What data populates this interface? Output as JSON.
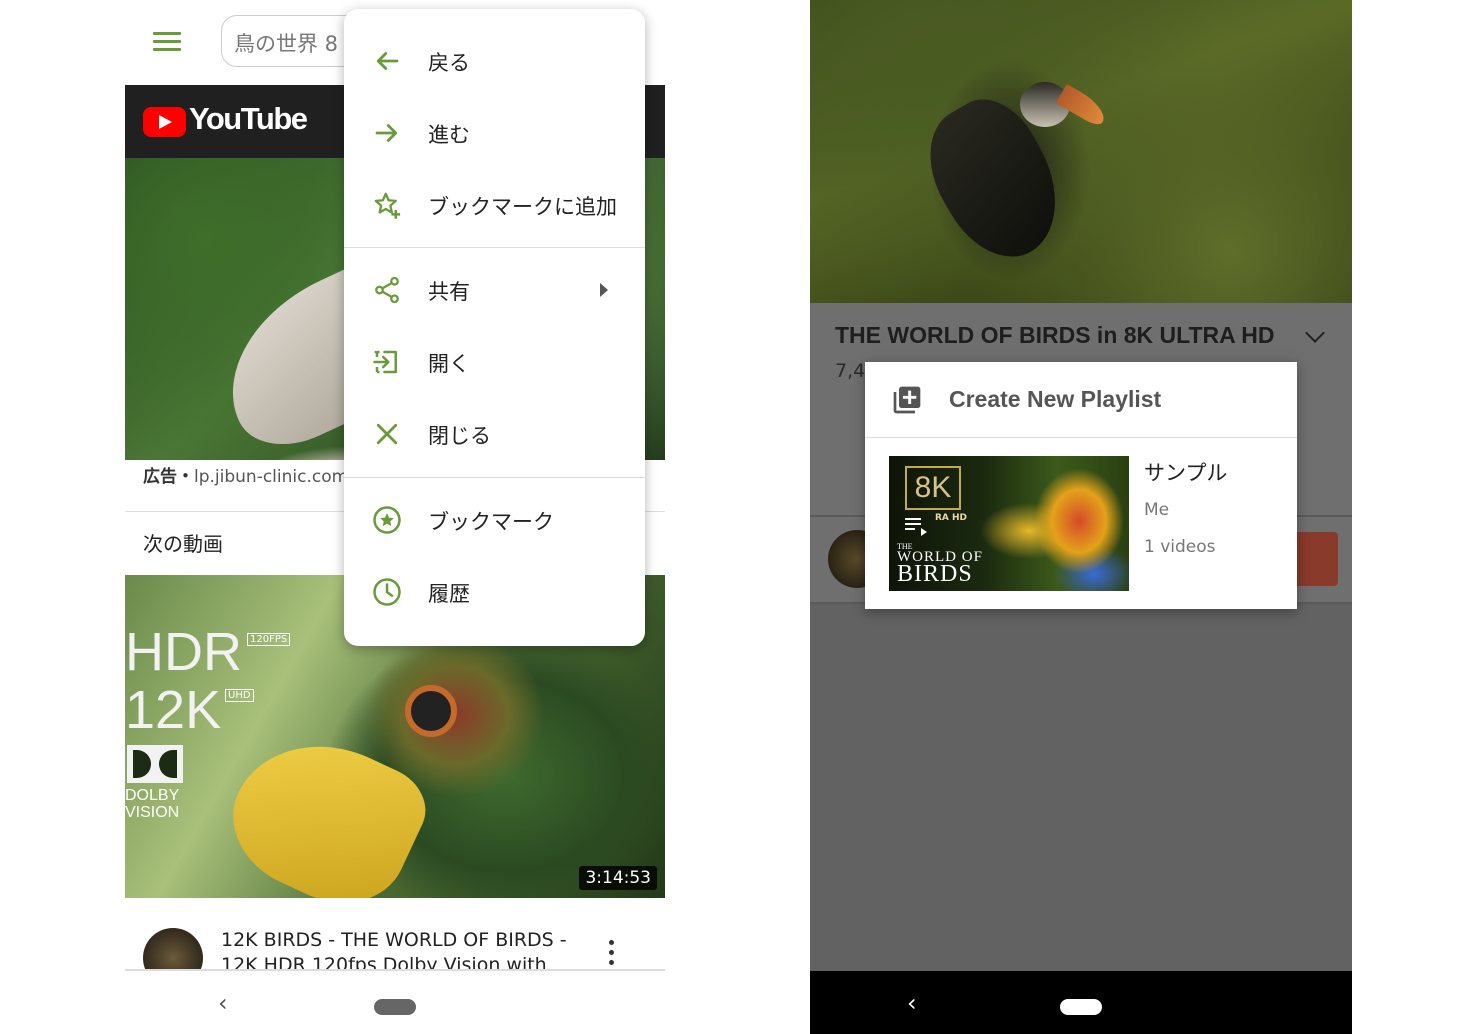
{
  "left": {
    "search": {
      "text": "鳥の世界 8"
    },
    "header": {
      "logo_text": "YouTube"
    },
    "ad": {
      "label": "広告・",
      "url": "lp.jibun-clinic.com"
    },
    "next_section": {
      "title": "次の動画"
    },
    "video": {
      "duration": "3:14:53",
      "title": "12K BIRDS - THE WORLD OF BIRDS - 12K HDR 120fps Dolby Vision with",
      "thumb_texts": {
        "hdr": "HDR",
        "fps": "120FPS",
        "k12": "12K",
        "uhd": "UHD",
        "dolby": "DOLBY VISION"
      }
    },
    "context_menu": {
      "items": [
        {
          "label": "戻る",
          "icon": "arrow-back-icon"
        },
        {
          "label": "進む",
          "icon": "arrow-forward-icon"
        },
        {
          "label": "ブックマークに追加",
          "icon": "star-add-icon"
        },
        {
          "label": "共有",
          "icon": "share-icon"
        },
        {
          "label": "開く",
          "icon": "open-in-icon"
        },
        {
          "label": "閉じる",
          "icon": "close-icon"
        },
        {
          "label": "ブックマーク",
          "icon": "star-circle-icon"
        },
        {
          "label": "履歴",
          "icon": "clock-icon"
        }
      ]
    }
  },
  "right": {
    "video_title": "THE WORLD OF BIRDS in 8K ULTRA HD",
    "views": "7,4",
    "dialog": {
      "create_label": "Create New Playlist",
      "playlists": [
        {
          "name": "サンプル",
          "owner": "Me",
          "count": "1 videos",
          "thumb_texts": {
            "k8": "8K",
            "hd": "RA HD",
            "the": "THE",
            "world": "WORLD OF",
            "birds": "BIRDS"
          }
        }
      ]
    }
  },
  "colors": {
    "accent_green": "#6a9a3a",
    "youtube_red": "#ff0000",
    "dim_overlay": "#626262"
  }
}
